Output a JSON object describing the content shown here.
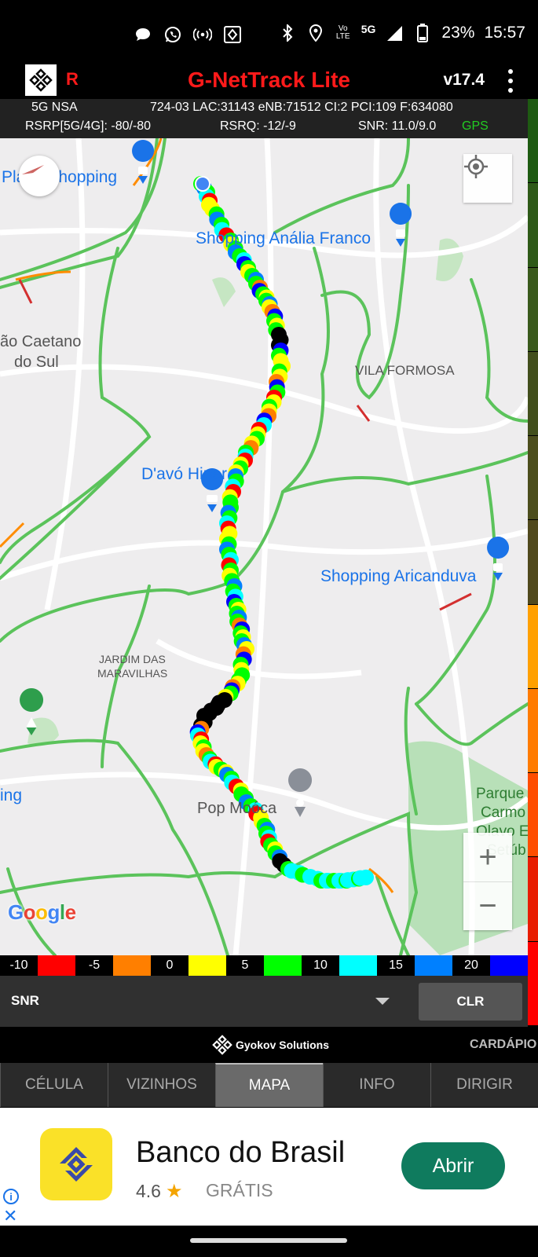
{
  "status_bar": {
    "time": "15:57",
    "battery_pct": "23%",
    "network": "5G",
    "volte": "Vo LTE",
    "icons_left": [
      "chat-bubble-icon",
      "whatsapp-icon",
      "hotspot-icon",
      "vibrate-icon"
    ],
    "icons_right": [
      "bluetooth-icon",
      "location-icon",
      "volte-icon",
      "signal-icon",
      "battery-icon"
    ]
  },
  "app": {
    "title": "G-NetTrack Lite",
    "version": "v17.4",
    "record_flag": "R"
  },
  "info": {
    "row1": {
      "tech": "5G NSA",
      "cell": "724-03 LAC:31143  eNB:71512 CI:2 PCI:109 F:634080"
    },
    "row2": {
      "rsrp": "RSRP[5G/4G]: -80/-80",
      "rsrq": "RSRQ: -12/-9",
      "snr": "SNR: 11.0/9.0",
      "gps": "GPS"
    },
    "gps_color": "#22cc22"
  },
  "signal_strip": [
    "#1e5b12",
    "#2e5a18",
    "#3a5a1c",
    "#424f1c",
    "#4c4e1d",
    "#50491d",
    "#ffa000",
    "#ff7b00",
    "#ff4d00",
    "#e81d00",
    "#ff0000"
  ],
  "map": {
    "labels": {
      "plaza": "Plaza Shopping",
      "analia": "Shopping Anália Franco",
      "sao_caetano_1": "ão Caetano",
      "sao_caetano_2": "do Sul",
      "vila_formosa": "VILA FORMOSA",
      "davo": "D'avó Hiper",
      "aricanduva": "Shopping Aricanduva",
      "jardim_1": "JARDIM DAS",
      "jardim_2": "MARAVILHAS",
      "ing": "ing",
      "pop": "Pop Moóca",
      "parque_1": "Parque",
      "parque_2": "Carmo",
      "parque_3": "Olavo Eg",
      "parque_4": "Setúb"
    },
    "google": [
      "G",
      "o",
      "o",
      "g",
      "l",
      "e"
    ],
    "google_colors": [
      "#4285f4",
      "#ea4335",
      "#fbbc05",
      "#4285f4",
      "#34a853",
      "#ea4335"
    ],
    "zoom_in": "+",
    "zoom_out": "−"
  },
  "legend": [
    {
      "label": "-10",
      "color": "#000000"
    },
    {
      "label": "",
      "color": "#ff0000"
    },
    {
      "label": "-5",
      "color": "#000000"
    },
    {
      "label": "",
      "color": "#ff7f00"
    },
    {
      "label": "0",
      "color": "#000000"
    },
    {
      "label": "",
      "color": "#ffff00"
    },
    {
      "label": "5",
      "color": "#000000"
    },
    {
      "label": "",
      "color": "#00ff00"
    },
    {
      "label": "10",
      "color": "#000000"
    },
    {
      "label": "",
      "color": "#00ffff"
    },
    {
      "label": "15",
      "color": "#000000"
    },
    {
      "label": "",
      "color": "#0080ff"
    },
    {
      "label": "20",
      "color": "#000000"
    },
    {
      "label": "",
      "color": "#0000ff"
    }
  ],
  "selector": {
    "label": "SNR",
    "clear": "CLR"
  },
  "brand": {
    "name": "Gyokov Solutions",
    "menu": "CARDÁPIO"
  },
  "tabs": [
    {
      "label": "CÉLULA",
      "active": false
    },
    {
      "label": "VIZINHOS",
      "active": false
    },
    {
      "label": "MAPA",
      "active": true
    },
    {
      "label": "INFO",
      "active": false
    },
    {
      "label": "DIRIGIR",
      "active": false
    }
  ],
  "ad": {
    "title": "Banco do Brasil",
    "rating": "4.6",
    "price": "GRÁTIS",
    "cta": "Abrir",
    "info": "i",
    "close": "✕"
  }
}
